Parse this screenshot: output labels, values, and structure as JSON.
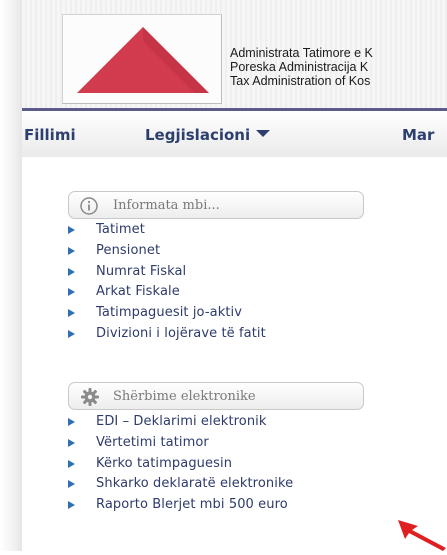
{
  "header": {
    "org_names": [
      "Administrata Tatimore e K",
      "Poreska Administracija K",
      "Tax Administration of Kos"
    ]
  },
  "nav": {
    "items": [
      {
        "label": "Fillimi"
      },
      {
        "label": "Legjislacioni",
        "has_dropdown": true
      },
      {
        "label": "Mar"
      }
    ]
  },
  "sidebar": {
    "info_section": {
      "title": "Informata mbi...",
      "icon": "info-circle-icon",
      "items": [
        "Tatimet",
        "Pensionet",
        "Numrat Fiskal",
        "Arkat Fiskale",
        "Tatimpaguesit jo-aktiv",
        "Divizioni i lojërave të fatit"
      ]
    },
    "services_section": {
      "title": "Shërbime elektronike",
      "icon": "gear-icon",
      "items": [
        "EDI – Deklarimi elektronik",
        "Vërtetimi tatimor",
        "Kërko tatimpaguesin",
        "Shkarko deklaratë elektronike",
        "Raporto Blerjet mbi 500 euro"
      ]
    }
  },
  "colors": {
    "nav_text": "#2c3f6e",
    "link_text": "#2e3b6b",
    "bullet": "#2f6fb3",
    "logo_red": "#d23a4e",
    "header_rule": "#5c5c8a",
    "annotation_arrow": "#e02020"
  }
}
